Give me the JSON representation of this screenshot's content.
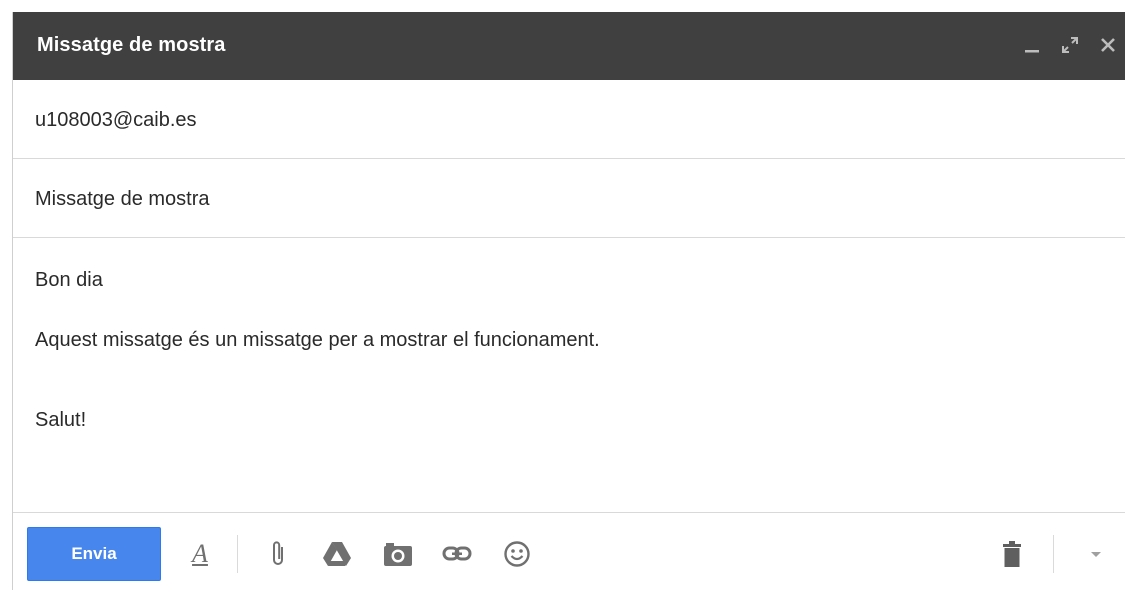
{
  "window": {
    "title": "Missatge de mostra"
  },
  "to": {
    "value": "u108003@caib.es"
  },
  "subject": {
    "value": "Missatge de mostra"
  },
  "body": {
    "lines": [
      "Bon dia",
      "Aquest missatge és un missatge per a mostrar el funcionament.",
      "Salut!"
    ]
  },
  "toolbar": {
    "send_label": "Envia",
    "format_label": "A",
    "icons": [
      "text-format-icon",
      "attach-icon",
      "drive-icon",
      "insert-photo-icon",
      "insert-link-icon",
      "emoji-icon",
      "trash-icon",
      "more-options-icon"
    ]
  },
  "colors": {
    "titlebar": "#404040",
    "send_button": "#4787ed",
    "icon": "#707070"
  }
}
